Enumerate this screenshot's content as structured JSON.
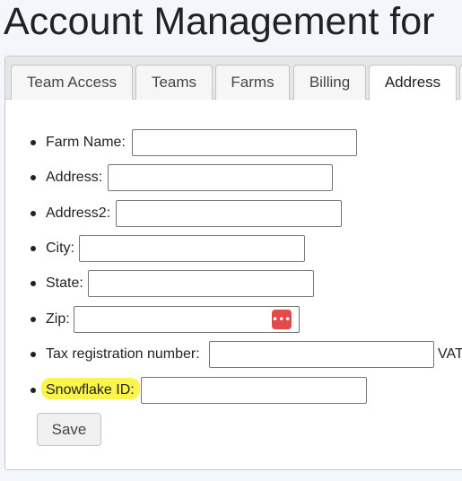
{
  "header": {
    "title": "Account Management for"
  },
  "tabs": [
    {
      "label": "Team Access",
      "active": false
    },
    {
      "label": "Teams",
      "active": false
    },
    {
      "label": "Farms",
      "active": false
    },
    {
      "label": "Billing",
      "active": false
    },
    {
      "label": "Address",
      "active": true
    }
  ],
  "form": {
    "fields": [
      {
        "label": "Farm Name:",
        "value": ""
      },
      {
        "label": "Address:",
        "value": ""
      },
      {
        "label": "Address2:",
        "value": ""
      },
      {
        "label": "City:",
        "value": ""
      },
      {
        "label": "State:",
        "value": ""
      },
      {
        "label": "Zip:",
        "value": "",
        "icon": "password-manager-icon"
      },
      {
        "label": "Tax registration number:",
        "value": "",
        "suffix": "VAT"
      },
      {
        "label": "Snowflake ID:",
        "value": "",
        "highlighted": true
      }
    ],
    "save_label": "Save"
  },
  "colors": {
    "highlight": "#fbf33a",
    "password_icon": "#e34b4b",
    "page_background": "#f3f6fb"
  }
}
